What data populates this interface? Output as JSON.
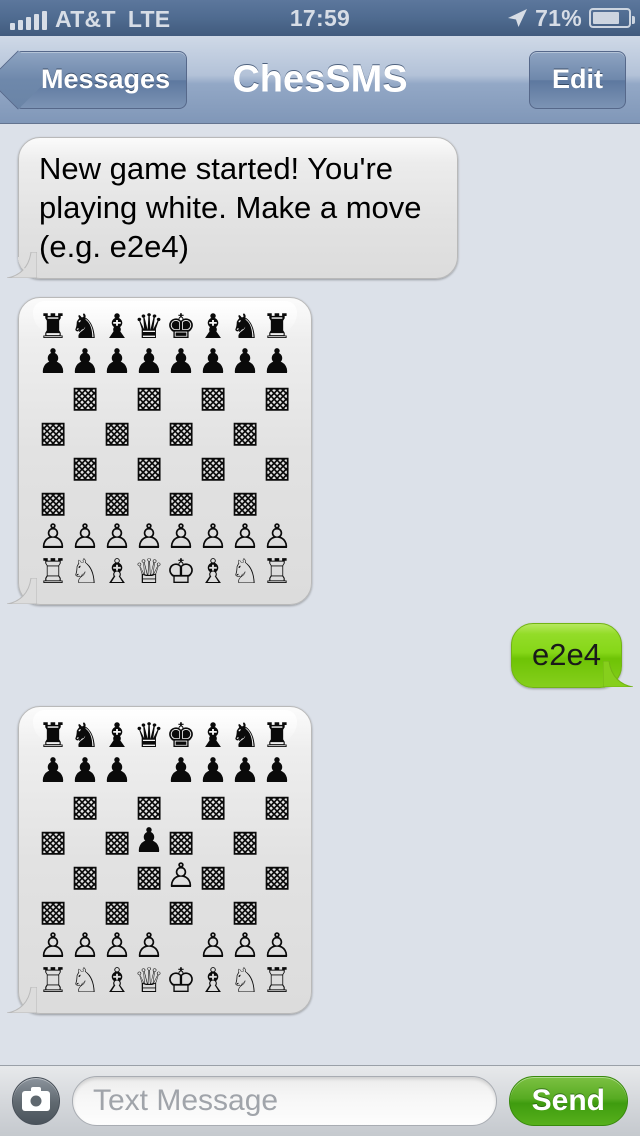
{
  "statusbar": {
    "carrier": "AT&T",
    "network": "LTE",
    "time": "17:59",
    "battery_percent": "71%",
    "signal_bars": 5,
    "location_icon": "location-arrow-icon"
  },
  "navbar": {
    "back_label": "Messages",
    "title": "ChesSMS",
    "edit_label": "Edit"
  },
  "messages": [
    {
      "id": "msg-intro",
      "side": "incoming",
      "type": "text",
      "text": "New game started! You're playing white. Make a move (e.g. e2e4)"
    },
    {
      "id": "msg-board-1",
      "side": "incoming",
      "type": "board",
      "board_ref": 0
    },
    {
      "id": "msg-move",
      "side": "outgoing",
      "type": "text",
      "text": "e2e4"
    },
    {
      "id": "msg-board-2",
      "side": "incoming",
      "type": "board",
      "board_ref": 1
    }
  ],
  "boards": [
    {
      "name": "starting-position",
      "rows": [
        [
          "♜",
          "♞",
          "♝",
          "♛",
          "♚",
          "♝",
          "♞",
          "♜"
        ],
        [
          "♟",
          "♟",
          "♟",
          "♟",
          "♟",
          "♟",
          "♟",
          "♟"
        ],
        [
          " ",
          "▩",
          " ",
          "▩",
          " ",
          "▩",
          " ",
          "▩"
        ],
        [
          "▩",
          " ",
          "▩",
          " ",
          "▩",
          " ",
          "▩",
          " "
        ],
        [
          " ",
          "▩",
          " ",
          "▩",
          " ",
          "▩",
          " ",
          "▩"
        ],
        [
          "▩",
          " ",
          "▩",
          " ",
          "▩",
          " ",
          "▩",
          " "
        ],
        [
          "♙",
          "♙",
          "♙",
          "♙",
          "♙",
          "♙",
          "♙",
          "♙"
        ],
        [
          "♖",
          "♘",
          "♗",
          "♕",
          "♔",
          "♗",
          "♘",
          "♖"
        ]
      ]
    },
    {
      "name": "after-e2e4-d7d5",
      "rows": [
        [
          "♜",
          "♞",
          "♝",
          "♛",
          "♚",
          "♝",
          "♞",
          "♜"
        ],
        [
          "♟",
          "♟",
          "♟",
          " ",
          "♟",
          "♟",
          "♟",
          "♟"
        ],
        [
          " ",
          "▩",
          " ",
          "▩",
          " ",
          "▩",
          " ",
          "▩"
        ],
        [
          "▩",
          " ",
          "▩",
          "♟",
          "▩",
          " ",
          "▩",
          " "
        ],
        [
          " ",
          "▩",
          " ",
          "▩",
          "♙",
          "▩",
          " ",
          "▩"
        ],
        [
          "▩",
          " ",
          "▩",
          " ",
          "▩",
          " ",
          "▩",
          " "
        ],
        [
          "♙",
          "♙",
          "♙",
          "♙",
          " ",
          "♙",
          "♙",
          "♙"
        ],
        [
          "♖",
          "♘",
          "♗",
          "♕",
          "♔",
          "♗",
          "♘",
          "♖"
        ]
      ]
    }
  ],
  "inputbar": {
    "camera_icon": "camera-icon",
    "placeholder": "Text Message",
    "field_value": "",
    "send_label": "Send"
  },
  "colors": {
    "background": "#dce1e9",
    "incoming_bubble": "#e2e2e2",
    "outgoing_bubble": "#86d718",
    "send_button": "#4fa81a",
    "navbar": "#93a8c6",
    "statusbar": "#4f6b90"
  }
}
